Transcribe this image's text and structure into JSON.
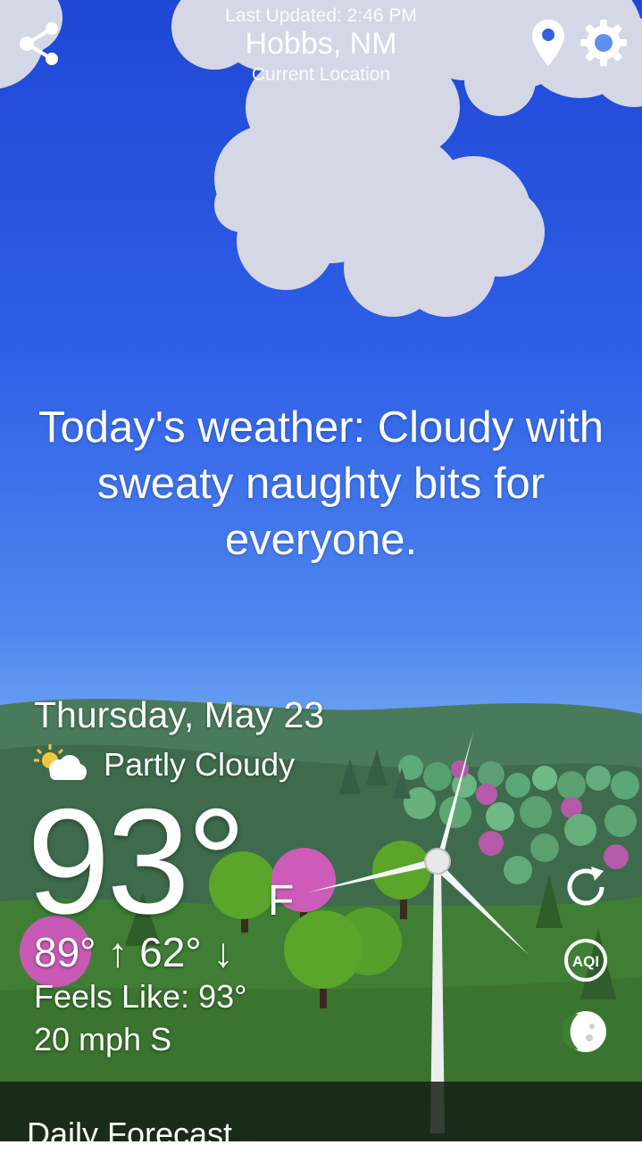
{
  "header": {
    "last_updated": "Last Updated: 2:46 PM",
    "city": "Hobbs, NM",
    "location_label": "Current Location"
  },
  "icons": {
    "share": "share-icon",
    "location": "location-pin-icon",
    "settings": "gear-icon",
    "condition": "partly-cloudy-icon",
    "refresh": "refresh-icon",
    "aqi": "aqi-icon",
    "moon": "moon-phase-icon"
  },
  "message": "Today's weather: Cloudy with sweaty naughty bits for everyone.",
  "current": {
    "date": "Thursday, May 23",
    "condition": "Partly Cloudy",
    "temperature": "93°",
    "unit": "F",
    "hi_lo": "89° ↑ 62° ↓",
    "feels_like": "Feels Like: 93°",
    "wind": "20 mph S"
  },
  "side_buttons": {
    "aqi_label": "AQI"
  },
  "footer": {
    "section_title": "Daily Forecast"
  },
  "colors": {
    "sky_top": "#1f47d6",
    "sky_bottom": "#a9d3f5",
    "hills": "#3d6b4c",
    "grass": "#3f7e34",
    "bar": "#16201680"
  }
}
